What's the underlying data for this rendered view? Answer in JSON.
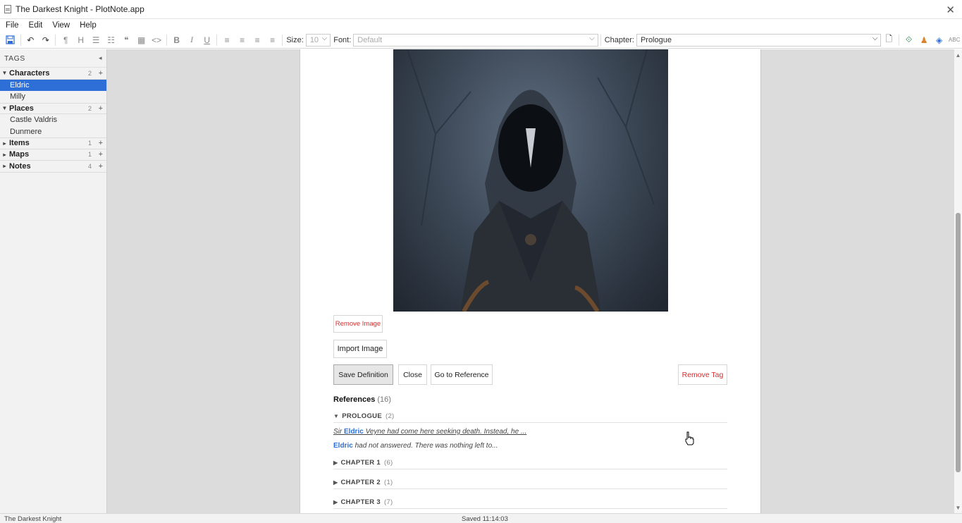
{
  "window": {
    "title": "The Darkest Knight - PlotNote.app"
  },
  "menu": [
    "File",
    "Edit",
    "View",
    "Help"
  ],
  "toolbar": {
    "size_label": "Size:",
    "size_value": "10",
    "font_label": "Font:",
    "font_value": "Default",
    "chapter_label": "Chapter:",
    "chapter_value": "Prologue"
  },
  "sidebar": {
    "header": "TAGS",
    "categories": [
      {
        "label": "Characters",
        "count": "2",
        "expanded": true,
        "items": [
          "Eldric",
          "Milly"
        ]
      },
      {
        "label": "Places",
        "count": "2",
        "expanded": true,
        "items": [
          "Castle Valdris",
          "Dunmere"
        ]
      },
      {
        "label": "Items",
        "count": "1",
        "expanded": false,
        "items": []
      },
      {
        "label": "Maps",
        "count": "1",
        "expanded": false,
        "items": []
      },
      {
        "label": "Notes",
        "count": "4",
        "expanded": false,
        "items": []
      }
    ],
    "selected_item": "Eldric"
  },
  "editor": {
    "remove_image": "Remove Image",
    "import_image": "Import Image",
    "save_definition": "Save Definition",
    "close": "Close",
    "go_to_reference": "Go to Reference",
    "remove_tag": "Remove Tag",
    "references_label": "References",
    "references_count": "(16)",
    "sections": [
      {
        "label": "PROLOGUE",
        "count": "(2)",
        "expanded": true
      },
      {
        "label": "CHAPTER 1",
        "count": "(6)",
        "expanded": false
      },
      {
        "label": "CHAPTER 2",
        "count": "(1)",
        "expanded": false
      },
      {
        "label": "CHAPTER 3",
        "count": "(7)",
        "expanded": false
      }
    ],
    "refs": [
      {
        "before": "Sir ",
        "name": "Eldric",
        "after": " Veyne had come here seeking death. Instead, he ..."
      },
      {
        "before": "",
        "name": "Eldric",
        "after": " had not answered. There was nothing left to..."
      }
    ]
  },
  "status": {
    "left": "The Darkest Knight",
    "middle": "Saved 11:14:03"
  },
  "colors": {
    "accent": "#2d6fd6",
    "danger": "#d32f2f"
  }
}
